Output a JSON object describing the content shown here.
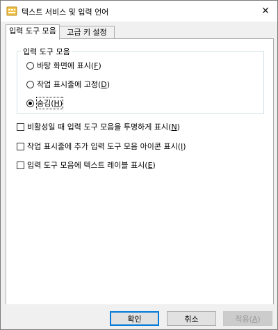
{
  "window": {
    "title": "텍스트 서비스 및 입력 언어",
    "icon": "keyboard-icon",
    "close_glyph": "✕"
  },
  "tabs": [
    {
      "label": "입력 도구 모음",
      "active": true
    },
    {
      "label": "고급 키 설정",
      "active": false
    }
  ],
  "language_bar": {
    "group_label": "입력 도구 모음",
    "options": [
      {
        "label": "바탕 화면에 표시(",
        "key": "F",
        "suffix": ")",
        "checked": false
      },
      {
        "label": "작업 표시줄에 고정(",
        "key": "D",
        "suffix": ")",
        "checked": false
      },
      {
        "label": "숨김(",
        "key": "H",
        "suffix": ")",
        "checked": true
      }
    ]
  },
  "checkboxes": [
    {
      "label": "비활성일 때 입력 도구 모음을 투명하게 표시(",
      "key": "N",
      "suffix": ")",
      "checked": false
    },
    {
      "label": "작업 표시줄에 추가 입력 도구 모음 아이콘 표시(",
      "key": "I",
      "suffix": ")",
      "checked": false
    },
    {
      "label": "입력 도구 모음에 텍스트 레이블 표시(",
      "key": "E",
      "suffix": ")",
      "checked": false
    }
  ],
  "buttons": {
    "ok": "확인",
    "cancel": "취소",
    "apply_label": "적용(",
    "apply_key": "A",
    "apply_suffix": ")"
  }
}
